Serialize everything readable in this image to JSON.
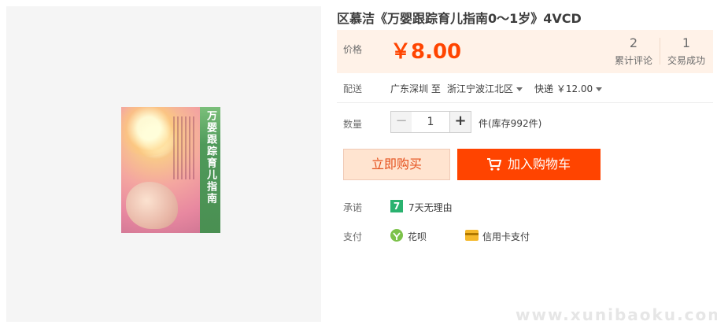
{
  "product": {
    "title": "区慕洁《万婴跟踪育儿指南0～1岁》4VCD",
    "cover_title": "万婴跟踪育儿指南"
  },
  "price_box": {
    "label": "价格",
    "price": "￥8.00",
    "reviews_count": "2",
    "reviews_label": "累计评论",
    "sales_count": "1",
    "sales_label": "交易成功"
  },
  "shipping": {
    "label": "配送",
    "from": "广东深圳 至",
    "to": "浙江宁波江北区",
    "method": "快递 ￥12.00"
  },
  "quantity": {
    "label": "数量",
    "value": "1",
    "minus": "−",
    "plus": "+",
    "stock": "件(库存992件)"
  },
  "actions": {
    "buy_now": "立即购买",
    "add_to_cart": "加入购物车"
  },
  "promise": {
    "label": "承诺",
    "icon_text": "7",
    "text": "7天无理由"
  },
  "payment": {
    "label": "支付",
    "method1": "花呗",
    "method2": "信用卡支付"
  },
  "watermark": "www.xunibaoku.com",
  "colors": {
    "accent": "#ff4400",
    "price_bg": "#fff2e8",
    "buy_now_bg": "#ffe4d0",
    "promise_green": "#2ab26f",
    "card_yellow": "#f5b82a"
  }
}
